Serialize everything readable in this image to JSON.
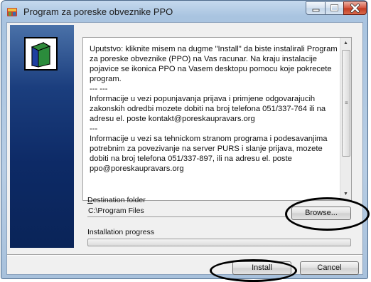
{
  "window": {
    "title": "Program za poreske obveznike PPO",
    "controls": {
      "minimize": "minimize-icon",
      "maximize": "maximize-icon",
      "close": "close-icon"
    }
  },
  "info": {
    "text": "Uputstvo: kliknite misem na dugme \"Install\" da biste instalirali Program za poreske obveznike (PPO) na Vas racunar. Na kraju instalacije pojavice se ikonica PPO na Vasem desktopu pomocu koje pokrecete program.\n--- ---\nInformacije u vezi popunjavanja prijava i primjene odgovarajucih zakonskih odredbi mozete dobiti na broj telefona 051/337-764 ili na adresu el. poste kontakt@poreskaupravars.org\n---\nInformacije u vezi sa tehnickom stranom programa i podesavanjima potrebnim za povezivanje na server PURS i slanje prijava, mozete dobiti na broj telefona 051/337-897, ili na adresu el. poste ppo@poreskaupravars.org"
  },
  "destination": {
    "label_first": "D",
    "label_rest": "estination folder",
    "value": "C:\\Program Files",
    "browse_label": "Browse..."
  },
  "progress": {
    "label": "Installation progress",
    "value_percent": 0
  },
  "buttons": {
    "install": "Install",
    "cancel": "Cancel"
  },
  "colors": {
    "side_panel": "#0d2a66",
    "close_button": "#c23a20",
    "annotation": "#000000"
  }
}
